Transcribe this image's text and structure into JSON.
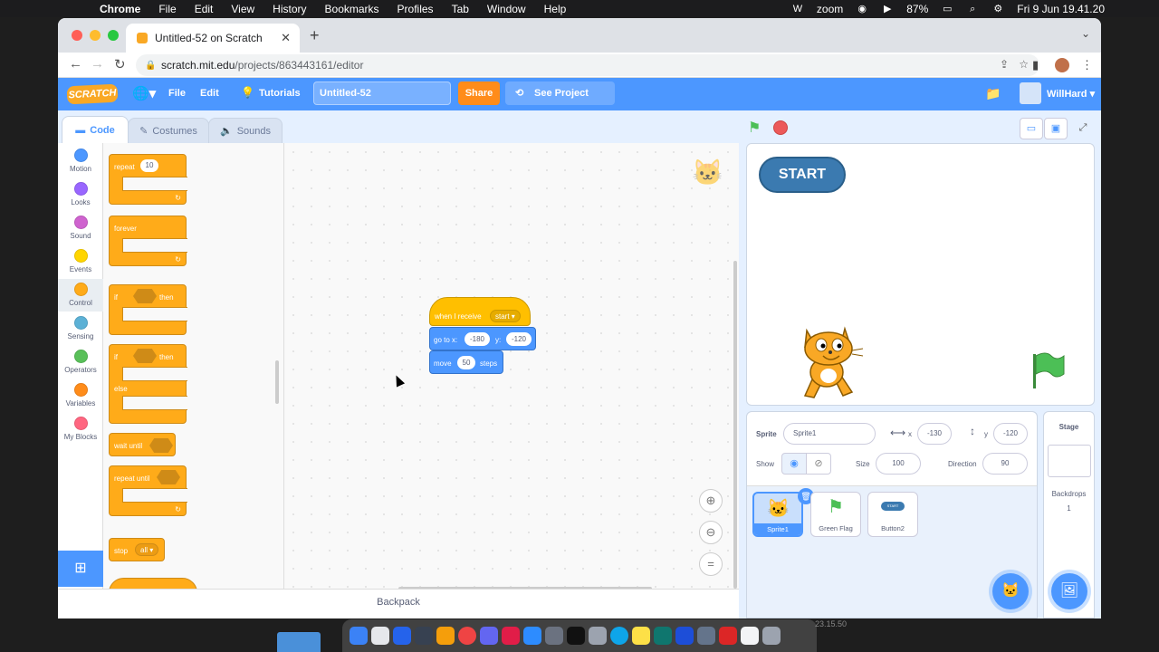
{
  "menubar": {
    "app": "Chrome",
    "items": [
      "File",
      "Edit",
      "View",
      "History",
      "Bookmarks",
      "Profiles",
      "Tab",
      "Window",
      "Help"
    ],
    "zoom_label": "zoom",
    "battery": "87%",
    "datetime": "Fri 9 Jun  19.41.20"
  },
  "browser": {
    "tab_title": "Untitled-52 on Scratch",
    "url_host": "scratch.mit.edu",
    "url_path": "/projects/863443161/editor"
  },
  "scratch_menu": {
    "logo": "SCRATCH",
    "file": "File",
    "edit": "Edit",
    "tutorials": "Tutorials",
    "project_title": "Untitled-52",
    "share": "Share",
    "see_project": "See Project Page",
    "username": "WillHard"
  },
  "editor_tabs": {
    "code": "Code",
    "costumes": "Costumes",
    "sounds": "Sounds"
  },
  "categories": [
    {
      "label": "Motion",
      "color": "#4c97ff"
    },
    {
      "label": "Looks",
      "color": "#9966ff"
    },
    {
      "label": "Sound",
      "color": "#cf63cf"
    },
    {
      "label": "Events",
      "color": "#ffd500"
    },
    {
      "label": "Control",
      "color": "#ffab19"
    },
    {
      "label": "Sensing",
      "color": "#5cb1d6"
    },
    {
      "label": "Operators",
      "color": "#59c059"
    },
    {
      "label": "Variables",
      "color": "#ff8c1a"
    },
    {
      "label": "My Blocks",
      "color": "#ff6680"
    }
  ],
  "flyout": {
    "repeat": "repeat",
    "repeat_count": "10",
    "forever": "forever",
    "if": "if",
    "then": "then",
    "else": "else",
    "wait_until": "wait until",
    "repeat_until": "repeat until",
    "stop": "stop",
    "stop_option": "all"
  },
  "script": {
    "hat": "when I receive",
    "message": "start",
    "goto_label": "go to x:",
    "goto_x": "-180",
    "goto_y_label": "y:",
    "goto_y": "-120",
    "move_label": "move",
    "move_steps": "50",
    "steps_label": "steps"
  },
  "backpack": "Backpack",
  "stage": {
    "start_button": "START"
  },
  "sprite_info": {
    "sprite_label": "Sprite",
    "sprite_name": "Sprite1",
    "x_label": "x",
    "x_value": "-130",
    "y_label": "y",
    "y_value": "-120",
    "show_label": "Show",
    "size_label": "Size",
    "size_value": "100",
    "direction_label": "Direction",
    "direction_value": "90"
  },
  "sprites": [
    {
      "name": "Sprite1"
    },
    {
      "name": "Green Flag"
    },
    {
      "name": "Button2",
      "badge": "START"
    }
  ],
  "stage_panel": {
    "title": "Stage",
    "backdrops_label": "Backdrops",
    "backdrops_count": "1"
  },
  "dock_time": "23.15.50"
}
